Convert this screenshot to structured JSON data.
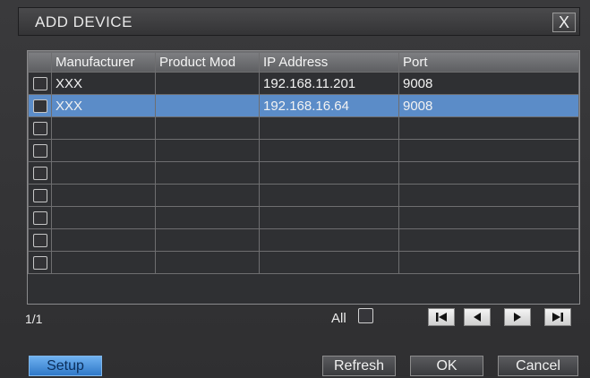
{
  "dialog": {
    "title": "ADD DEVICE",
    "close_label": "X"
  },
  "table": {
    "columns": [
      "",
      "Manufacturer",
      "Product Mod",
      "IP Address",
      "Port"
    ],
    "rows": [
      {
        "manufacturer": "XXX",
        "product": "",
        "ip": "192.168.11.201",
        "port": "9008",
        "selected": false
      },
      {
        "manufacturer": "XXX",
        "product": "",
        "ip": "192.168.16.64",
        "port": "9008",
        "selected": true
      },
      {
        "manufacturer": "",
        "product": "",
        "ip": "",
        "port": "",
        "selected": false
      },
      {
        "manufacturer": "",
        "product": "",
        "ip": "",
        "port": "",
        "selected": false
      },
      {
        "manufacturer": "",
        "product": "",
        "ip": "",
        "port": "",
        "selected": false
      },
      {
        "manufacturer": "",
        "product": "",
        "ip": "",
        "port": "",
        "selected": false
      },
      {
        "manufacturer": "",
        "product": "",
        "ip": "",
        "port": "",
        "selected": false
      },
      {
        "manufacturer": "",
        "product": "",
        "ip": "",
        "port": "",
        "selected": false
      },
      {
        "manufacturer": "",
        "product": "",
        "ip": "",
        "port": "",
        "selected": false
      }
    ]
  },
  "footer": {
    "page_info": "1/1",
    "all_label": "All"
  },
  "buttons": {
    "setup": "Setup",
    "refresh": "Refresh",
    "ok": "OK",
    "cancel": "Cancel"
  },
  "colors": {
    "selected_row": "#5b8cc8",
    "setup_button": "#2f78c8"
  },
  "icons": {
    "first": "first-page-icon",
    "prev": "prev-page-icon",
    "next": "next-page-icon",
    "last": "last-page-icon"
  }
}
